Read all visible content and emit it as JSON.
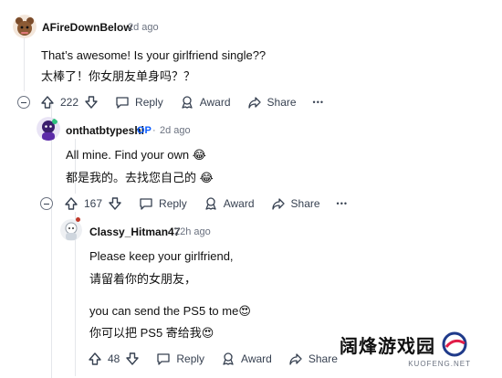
{
  "comments": [
    {
      "author": "AFireDownBelow",
      "time": "2d ago",
      "dot": "·",
      "lines": [
        "That’s awesome! Is your girlfriend single??",
        "太棒了！你女朋友单身吗？？"
      ],
      "actions": {
        "votes": "222",
        "reply": "Reply",
        "award": "Award",
        "share": "Share",
        "more": "•••"
      }
    },
    {
      "author": "onthatbtypeshi",
      "op": "OP",
      "time": "2d ago",
      "dot": "·",
      "lines": [
        "All mine. Find your own 😂",
        "都是我的。去找您自己的 😂"
      ],
      "actions": {
        "votes": "167",
        "reply": "Reply",
        "award": "Award",
        "share": "Share",
        "more": "•••"
      }
    },
    {
      "author": "Classy_Hitman47",
      "time": "22h ago",
      "dot": "·",
      "lines": [
        "Please keep your girlfriend,",
        "请留着你的女朋友，",
        "you can send the PS5 to me😍",
        "你可以把 PS5 寄给我😍"
      ],
      "actions": {
        "votes": "48",
        "reply": "Reply",
        "award": "Award",
        "share": "Share"
      }
    }
  ],
  "watermark": {
    "title": "阔烽游戏园",
    "sub": "KUOFENG.NET"
  }
}
